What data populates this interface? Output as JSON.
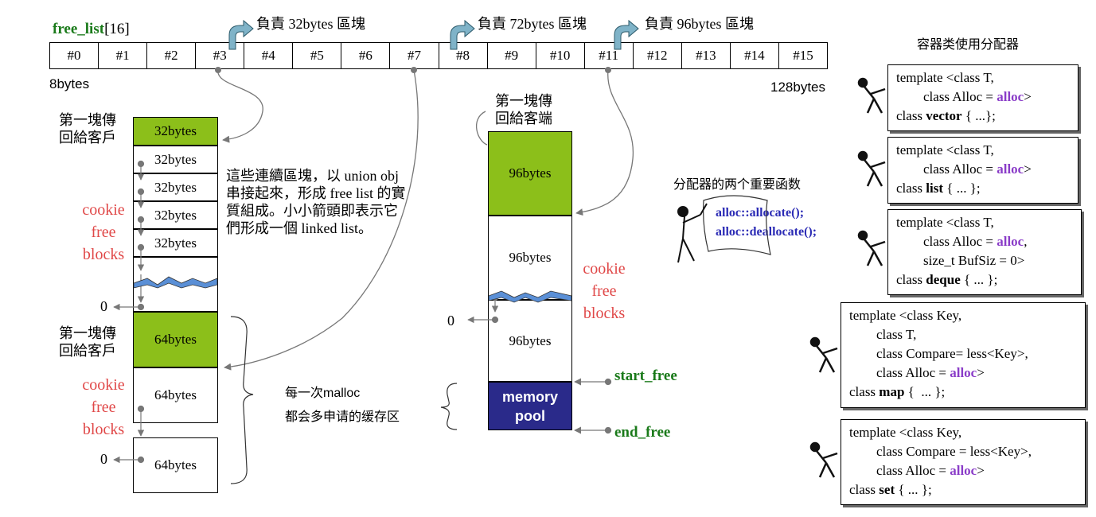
{
  "free_list": {
    "title_bold": "free_list",
    "title_suffix": "[16]",
    "cells": [
      "#0",
      "#1",
      "#2",
      "#3",
      "#4",
      "#5",
      "#6",
      "#7",
      "#8",
      "#9",
      "#10",
      "#11",
      "#12",
      "#13",
      "#14",
      "#15"
    ],
    "left_label": "8bytes",
    "right_label": "128bytes"
  },
  "responsible": [
    "負責 32bytes 區塊",
    "負責 72bytes 區塊",
    "負責 96bytes 區塊"
  ],
  "left_column": {
    "first_block_label_line1": "第一塊傳",
    "first_block_label_line2": "回給客戶",
    "blocks32": [
      "32bytes",
      "32bytes",
      "32bytes",
      "32bytes",
      "32bytes"
    ],
    "cookie_lines": [
      "cookie",
      "free",
      "blocks"
    ],
    "zero": "0",
    "second_label_line1": "第一塊傳",
    "second_label_line2": "回給客戶",
    "blocks64": [
      "64bytes",
      "64bytes",
      "64bytes"
    ],
    "cookie2_lines": [
      "cookie",
      "free",
      "blocks"
    ],
    "zero2": "0"
  },
  "explanation": [
    "這些連續區塊，以 union obj",
    "串接起來，形成 free list 的實",
    "質組成。小小箭頭即表示它",
    "們形成一個 linked list。"
  ],
  "middle_column": {
    "label_line1": "第一塊傳",
    "label_line2": "回給客端",
    "blocks96": [
      "96bytes",
      "96bytes",
      "96bytes"
    ],
    "cookie_lines": [
      "cookie",
      "free",
      "blocks"
    ],
    "zero": "0",
    "memory_pool_line1": "memory",
    "memory_pool_line2": "pool",
    "start_free": "start_free",
    "end_free": "end_free"
  },
  "malloc_note": [
    "每一次malloc",
    "都会多申请的缓存区"
  ],
  "allocator": {
    "title": "分配器的两个重要函数",
    "fn1": "alloc::allocate();",
    "fn2": "alloc::deallocate();"
  },
  "containers": {
    "title": "容器类使用分配器",
    "vector": [
      "template <class T,",
      "        class Alloc = ",
      "alloc",
      ">",
      "class ",
      "vector",
      " { ...};"
    ],
    "list": [
      "template <class T,",
      "        class Alloc = ",
      "alloc",
      ">",
      "class ",
      "list",
      " { ... };"
    ],
    "deque": [
      "template <class T,",
      "        class Alloc = ",
      "alloc",
      ",",
      "        size_t BufSiz = 0>",
      "class ",
      "deque",
      " { ... };"
    ],
    "map": [
      "template <class Key,",
      "        class T,",
      "        class Compare= less<Key>,",
      "        class Alloc = ",
      "alloc",
      ">",
      "class ",
      "map",
      " {  ... };"
    ],
    "set": [
      "template <class Key,",
      "        class Compare = less<Key>,",
      "        class Alloc = ",
      "alloc",
      ">",
      "class ",
      "set",
      " { ... };"
    ]
  },
  "colors": {
    "green": "#8cbf1a",
    "pool": "#2a2a8a",
    "cookie": "#e04848",
    "keyword": "#8a3cc8",
    "ptr_label": "#1a7a1a"
  }
}
